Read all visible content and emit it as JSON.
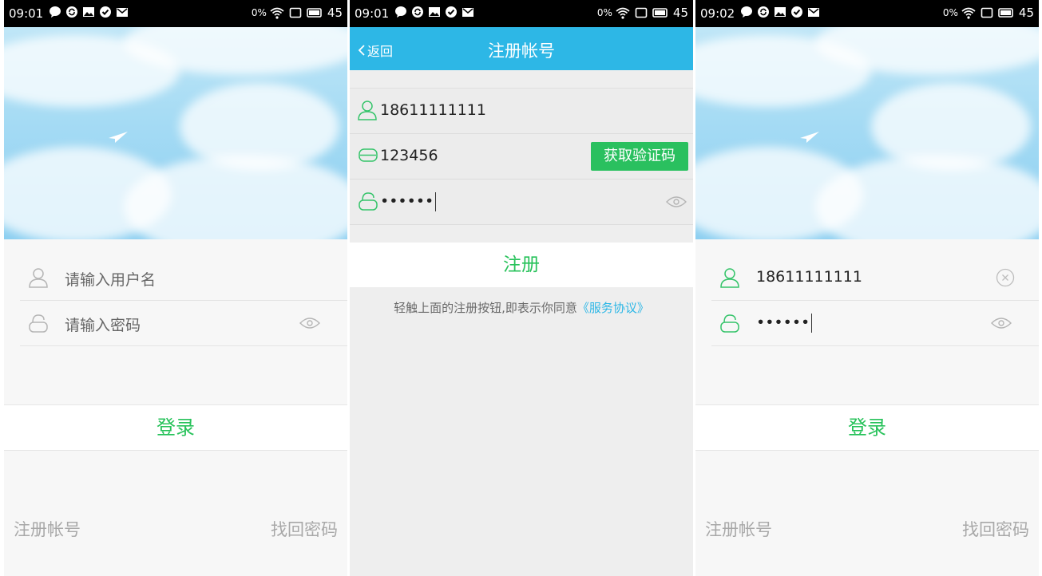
{
  "status_bars": [
    {
      "time": "09:01",
      "battery_pct": "0%",
      "battery_level": "45"
    },
    {
      "time": "09:01",
      "battery_pct": "0%",
      "battery_level": "45"
    },
    {
      "time": "09:02",
      "battery_pct": "0%",
      "battery_level": "45"
    }
  ],
  "login_empty": {
    "username_placeholder": "请输入用户名",
    "password_placeholder": "请输入密码",
    "login_label": "登录",
    "register_link": "注册帐号",
    "forgot_link": "找回密码"
  },
  "register": {
    "back_label": "返回",
    "title": "注册帐号",
    "phone_value": "18611111111",
    "code_value": "123456",
    "password_mask": "••••••",
    "get_code_label": "获取验证码",
    "register_label": "注册",
    "agreement_text": "轻触上面的注册按钮,即表示你同意",
    "agreement_link": "《服务协议》"
  },
  "login_filled": {
    "username_value": "18611111111",
    "password_mask": "••••••",
    "login_label": "登录",
    "register_link": "注册帐号",
    "forgot_link": "找回密码"
  },
  "colors": {
    "accent_green": "#27c25a",
    "title_blue": "#2db7e6",
    "link_blue": "#2db7e6"
  }
}
